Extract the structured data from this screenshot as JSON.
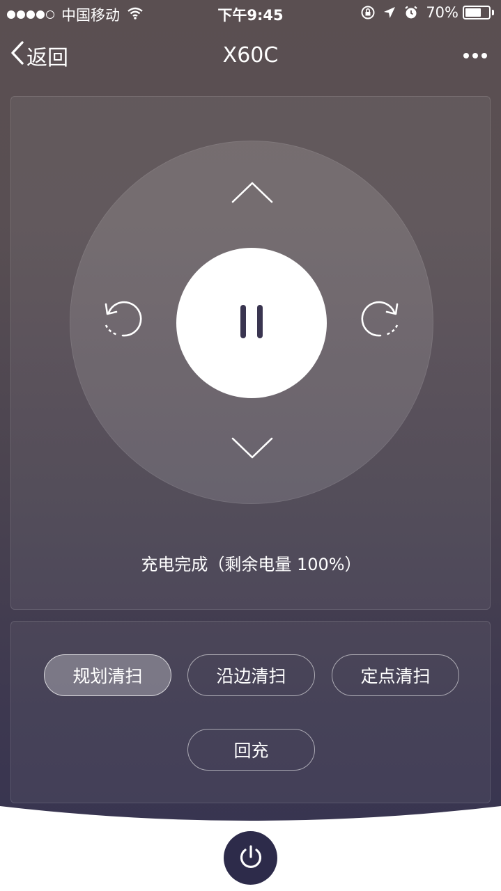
{
  "status_bar": {
    "carrier": "中国移动",
    "time": "下午9:45",
    "battery_percent": "70%",
    "battery_level": 0.7,
    "icons": [
      "signal-dots",
      "wifi-icon",
      "orientation-lock-icon",
      "location-icon",
      "alarm-icon",
      "battery-icon"
    ]
  },
  "nav": {
    "back_label": "返回",
    "title": "X60C",
    "more_icon": "more-icon"
  },
  "controls": {
    "up_icon": "chevron-up-icon",
    "down_icon": "chevron-down-icon",
    "left_icon": "rotate-left-icon",
    "right_icon": "rotate-right-icon",
    "center_icon": "pause-icon"
  },
  "status": {
    "text": "充电完成（剩余电量 100%）"
  },
  "modes": [
    {
      "label": "规划清扫",
      "active": true
    },
    {
      "label": "沿边清扫",
      "active": false
    },
    {
      "label": "定点清扫",
      "active": false
    },
    {
      "label": "回充",
      "active": false
    }
  ],
  "power": {
    "icon": "power-icon"
  },
  "colors": {
    "header_bg": "#5a4f51",
    "footer_bg": "#353351",
    "power_button": "#2d2b4a",
    "text": "#ffffff"
  }
}
